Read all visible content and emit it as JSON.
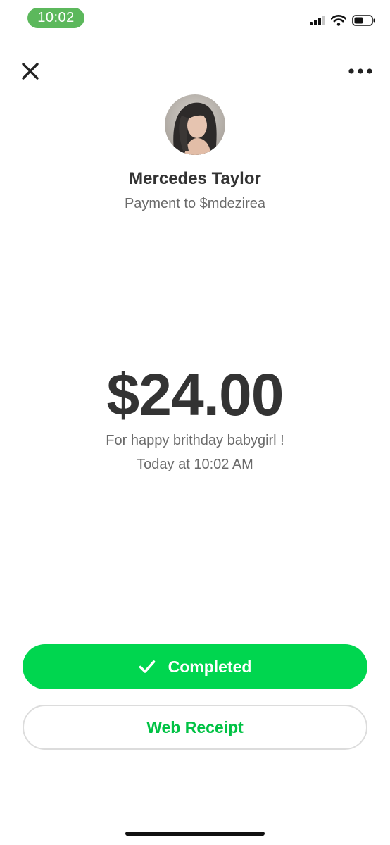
{
  "status_bar": {
    "time": "10:02",
    "icons": [
      "signal-bars-icon",
      "wifi-icon",
      "battery-icon"
    ]
  },
  "header": {
    "close_icon": "close-icon",
    "more_icon": "more-horizontal-icon"
  },
  "recipient": {
    "name": "Mercedes Taylor",
    "payment_to": "Payment to $mdezirea"
  },
  "payment": {
    "amount": "$24.00",
    "note": "For happy brithday babygirl !",
    "timestamp": "Today at 10:02 AM"
  },
  "actions": {
    "status_label": "Completed",
    "receipt_label": "Web Receipt"
  },
  "colors": {
    "accent_green": "#00d64f",
    "status_pill_green": "#5cb85c",
    "text_dark": "#333333",
    "text_muted": "#6b6b6b"
  }
}
